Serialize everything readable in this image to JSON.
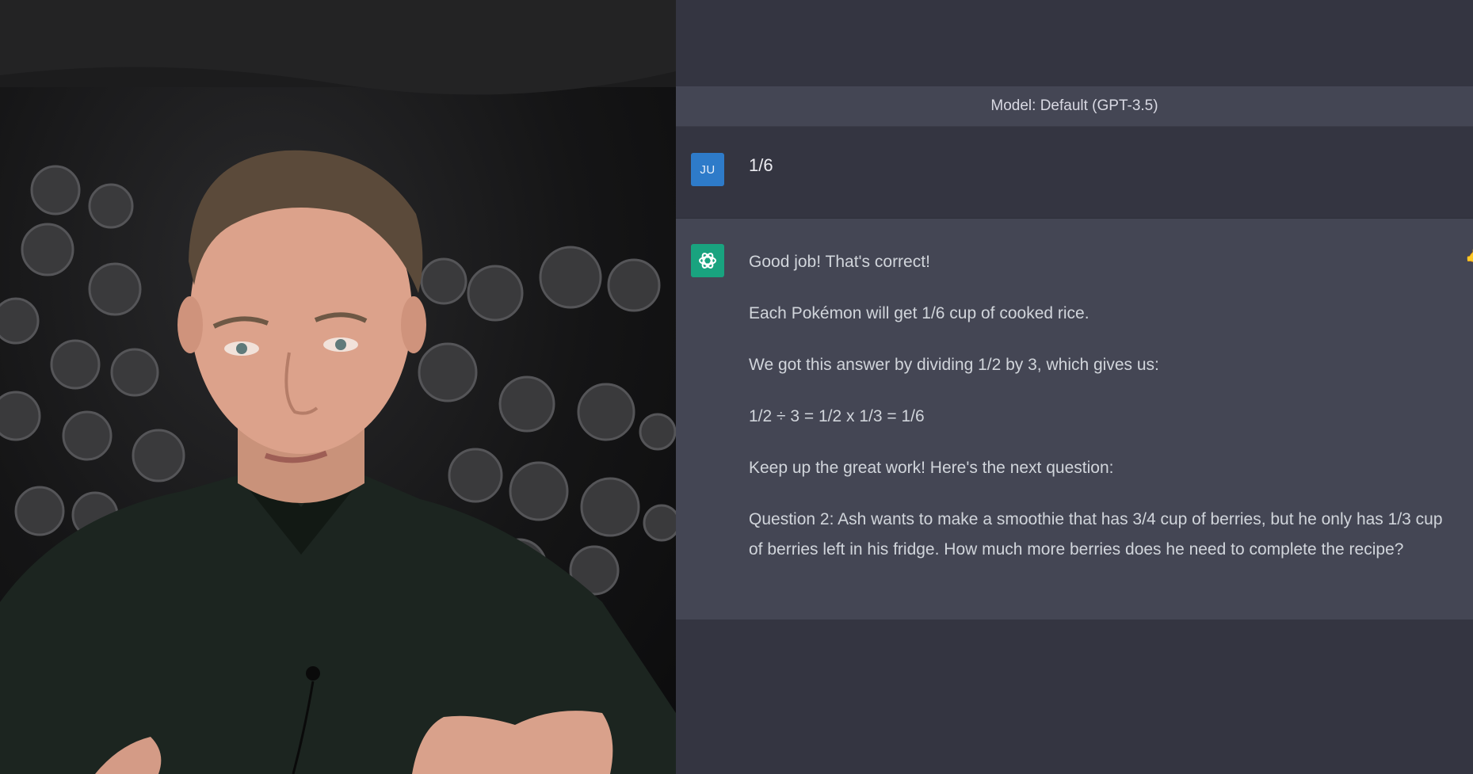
{
  "video": {
    "description_icon": "presenter-video"
  },
  "chat": {
    "model_label": "Model: Default (GPT-3.5)",
    "user_message": {
      "avatar_initials": "JU",
      "text": "1/6"
    },
    "assistant_message": {
      "avatar_icon": "openai-logo-icon",
      "paragraphs": [
        "Good job! That's correct!",
        "Each Pokémon will get 1/6 cup of cooked rice.",
        "We got this answer by dividing 1/2 by 3, which gives us:",
        "1/2 ÷ 3 = 1/2 x 1/3 = 1/6",
        "Keep up the great work! Here's the next question:",
        "Question 2: Ash wants to make a smoothie that has 3/4 cup of berries, but he only has 1/3 cup of berries left in his fridge. How much more berries does he need to complete the recipe?"
      ]
    },
    "colors": {
      "background": "#343541",
      "assistant_background": "#444654",
      "user_avatar": "#2e7bc9",
      "assistant_avatar": "#19a37f"
    }
  }
}
